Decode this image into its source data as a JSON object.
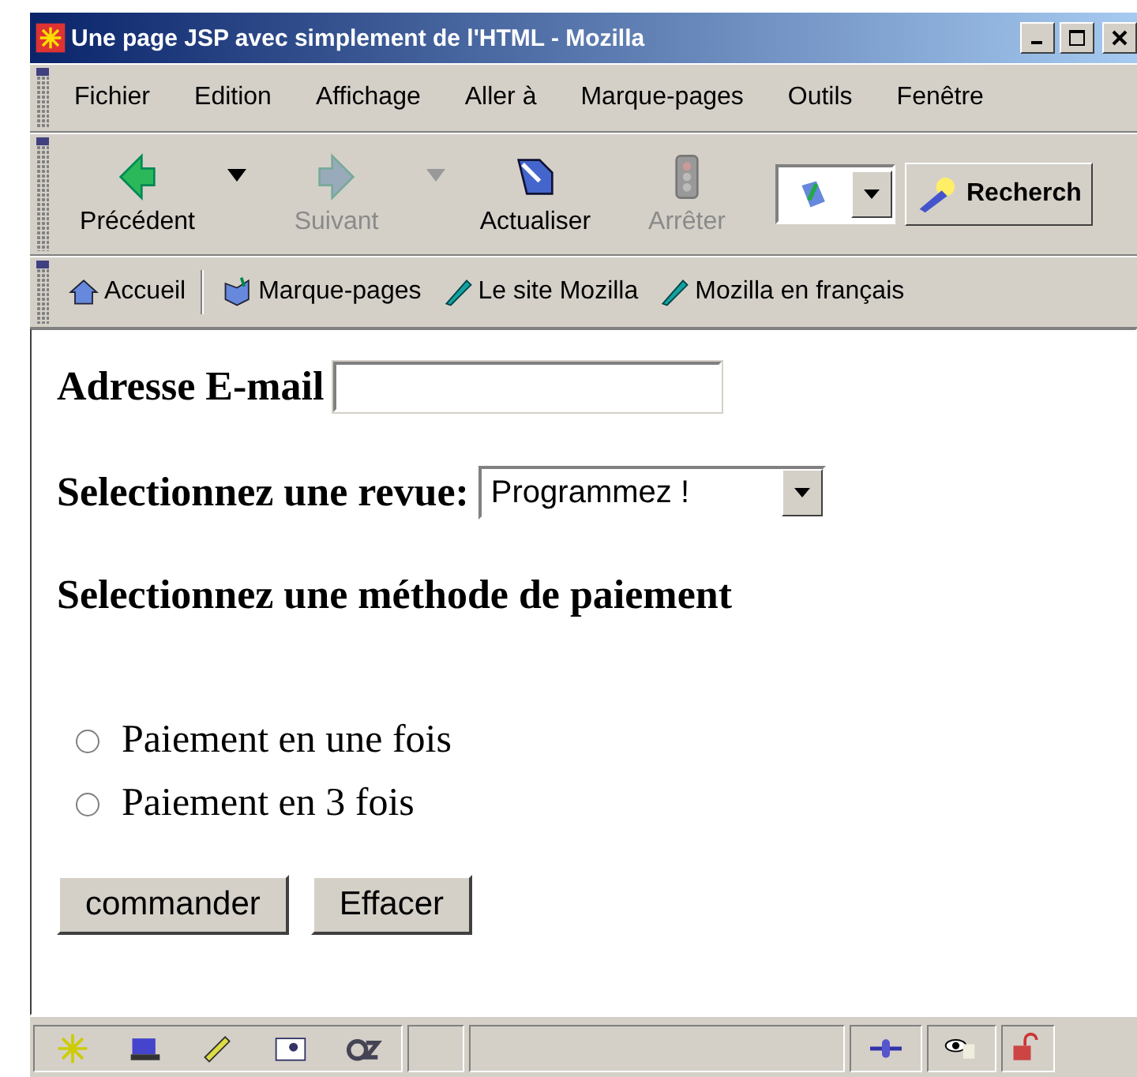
{
  "window": {
    "title": "Une page JSP avec simplement de l'HTML - Mozilla"
  },
  "menu": [
    "Fichier",
    "Edition",
    "Affichage",
    "Aller à",
    "Marque-pages",
    "Outils",
    "Fenêtre"
  ],
  "navigation": [
    {
      "label": "Précédent",
      "kind": "back",
      "disabled": false,
      "dropdown": true
    },
    {
      "label": "Suivant",
      "kind": "forward",
      "disabled": true,
      "dropdown": true
    },
    {
      "label": "Actualiser",
      "kind": "reload",
      "disabled": false,
      "dropdown": false
    },
    {
      "label": "Arrêter",
      "kind": "stop",
      "disabled": true,
      "dropdown": false
    }
  ],
  "search_button": {
    "label": "Recherch"
  },
  "bookmarks": [
    {
      "label": "Accueil",
      "kind": "home"
    },
    {
      "label": "Marque-pages",
      "kind": "bookmarks"
    },
    {
      "label": "Le site Mozilla",
      "kind": "link"
    },
    {
      "label": "Mozilla en français",
      "kind": "link"
    }
  ],
  "form": {
    "email": {
      "label": "Adresse E-mail"
    },
    "review": {
      "label": "Selectionnez une revue:",
      "value": "Programmez !"
    },
    "payment": {
      "heading": "Selectionnez une méthode de paiement",
      "options": [
        {
          "label": "Paiement en une fois",
          "selected": false
        },
        {
          "label": "Paiement en 3 fois",
          "selected": false
        }
      ]
    },
    "buttons": [
      "commander",
      "Effacer"
    ]
  }
}
